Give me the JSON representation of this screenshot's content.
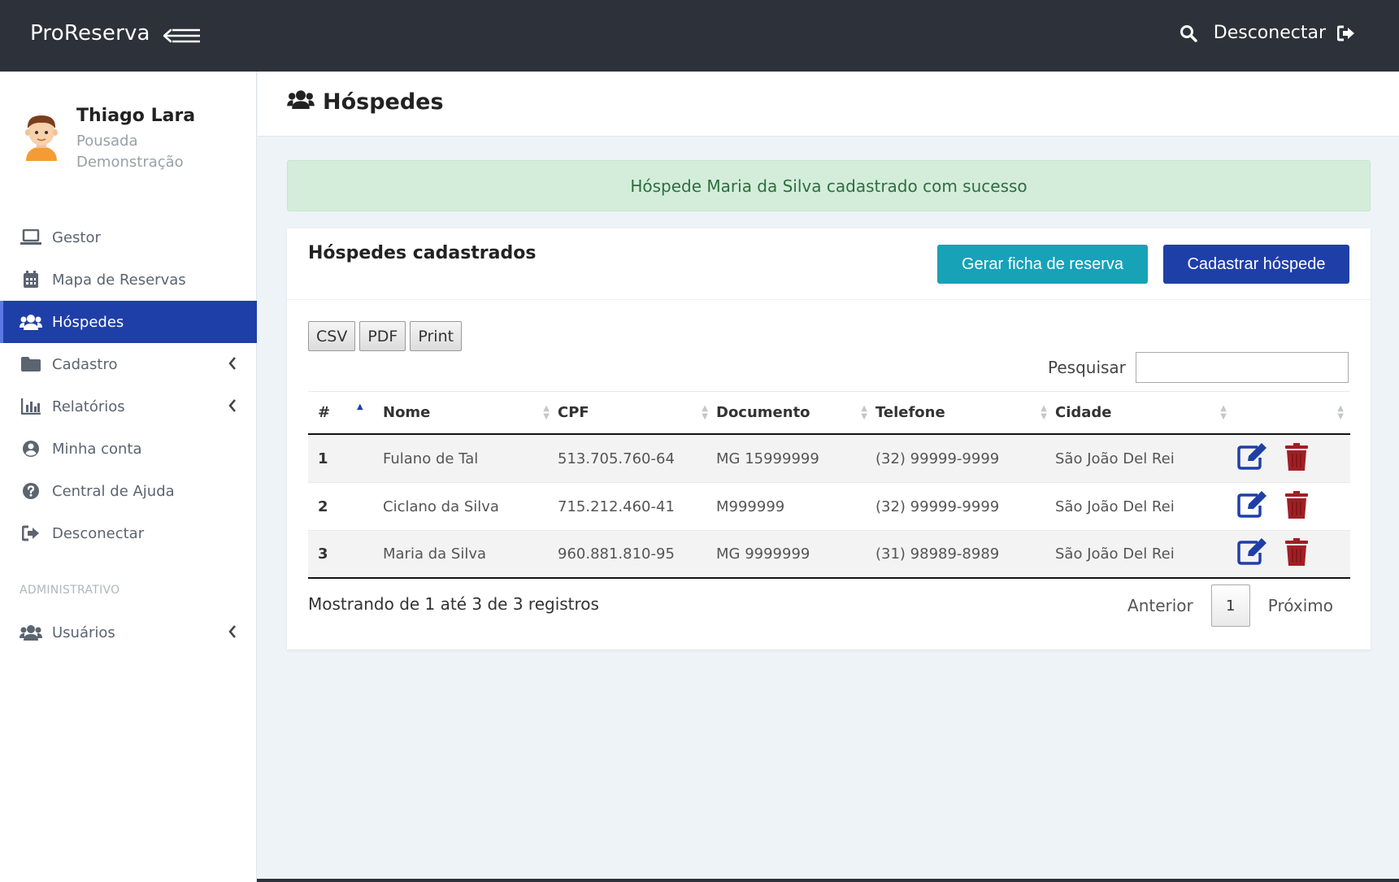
{
  "topbar": {
    "brand": "ProReserva",
    "logout_label": "Desconectar"
  },
  "profile": {
    "name": "Thiago Lara",
    "subtitle": "Pousada Demonstração"
  },
  "sidebar": {
    "items": [
      {
        "label": "Gestor",
        "icon": "laptop-icon"
      },
      {
        "label": "Mapa de Reservas",
        "icon": "calendar-icon"
      },
      {
        "label": "Hóspedes",
        "icon": "users-icon",
        "active": true
      },
      {
        "label": "Cadastro",
        "icon": "folder-icon",
        "submenu": true
      },
      {
        "label": "Relatórios",
        "icon": "bar-chart-icon",
        "submenu": true
      },
      {
        "label": "Minha conta",
        "icon": "user-circle-icon"
      },
      {
        "label": "Central de Ajuda",
        "icon": "question-circle-icon"
      },
      {
        "label": "Desconectar",
        "icon": "sign-out-icon"
      }
    ],
    "section_admin": "ADMINISTRATIVO",
    "admin_items": [
      {
        "label": "Usuários",
        "icon": "users-icon",
        "submenu": true
      }
    ]
  },
  "page": {
    "title": "Hóspedes"
  },
  "alert": {
    "message": "Hóspede Maria da Silva cadastrado com sucesso"
  },
  "card": {
    "title": "Hóspedes cadastrados",
    "btn_generate": "Gerar ficha de reserva",
    "btn_register": "Cadastrar hóspede",
    "export": [
      "CSV",
      "PDF",
      "Print"
    ],
    "search_label": "Pesquisar",
    "search_value": ""
  },
  "table": {
    "columns": [
      "#",
      "Nome",
      "CPF",
      "Documento",
      "Telefone",
      "Cidade",
      ""
    ],
    "rows": [
      {
        "id": "1",
        "nome": "Fulano de Tal",
        "cpf": "513.705.760-64",
        "documento": "MG 15999999",
        "telefone": "(32) 99999-9999",
        "cidade": "São João Del Rei"
      },
      {
        "id": "2",
        "nome": "Ciclano da Silva",
        "cpf": "715.212.460-41",
        "documento": "M999999",
        "telefone": "(32) 99999-9999",
        "cidade": "São João Del Rei"
      },
      {
        "id": "3",
        "nome": "Maria da Silva",
        "cpf": "960.881.810-95",
        "documento": "MG 9999999",
        "telefone": "(31) 98989-8989",
        "cidade": "São João Del Rei"
      }
    ]
  },
  "footer": {
    "info": "Mostrando de 1 até 3 de 3 registros",
    "prev": "Anterior",
    "page": "1",
    "next": "Próximo"
  },
  "colors": {
    "topbar": "#2d3139",
    "primary": "#1f3fa8",
    "teal": "#17a2b8",
    "edit_icon": "#1f3fa8",
    "delete_icon": "#a11f24",
    "alert_bg": "#d4eddb"
  }
}
